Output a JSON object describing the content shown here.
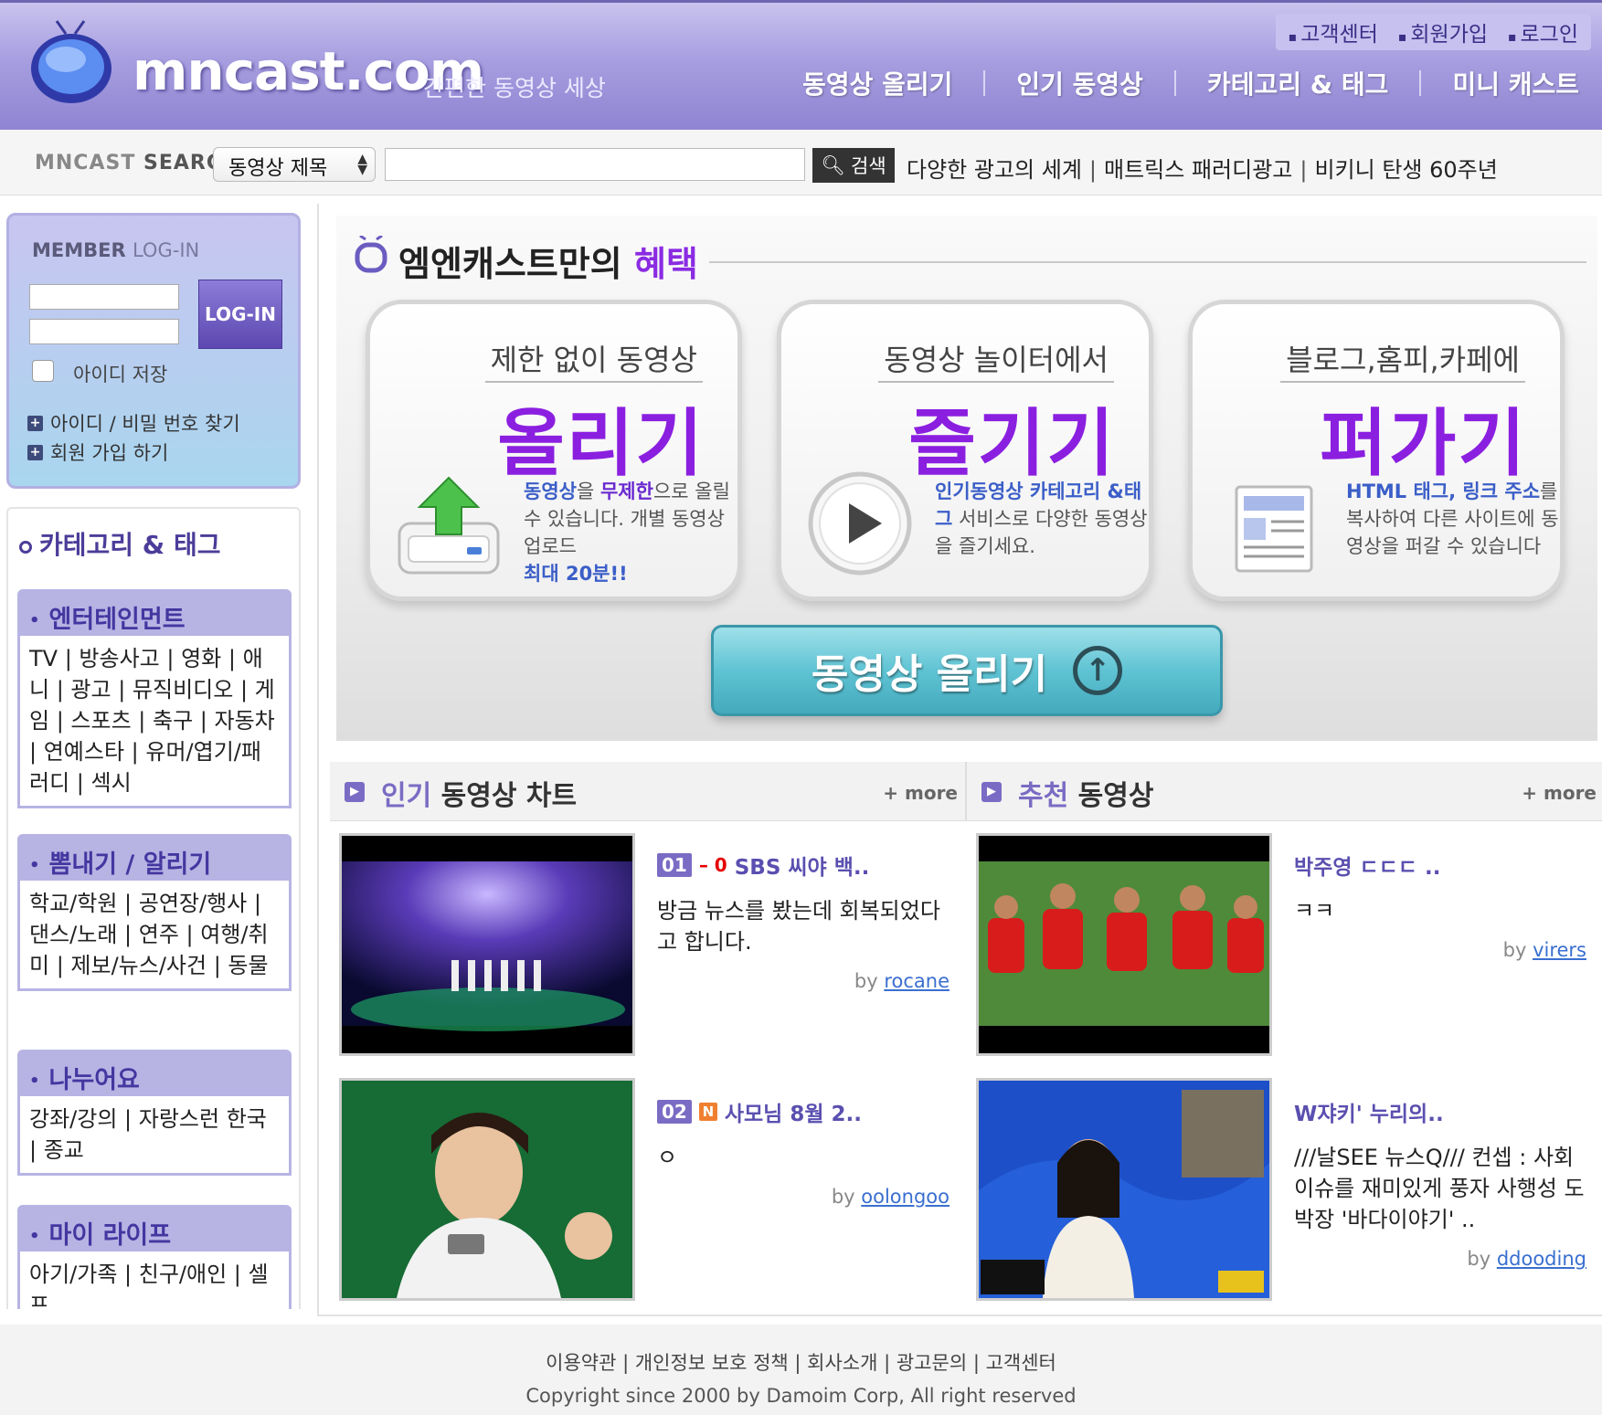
{
  "header": {
    "logo_text": "mncast.com",
    "slogan": "간편한 동영상 세상",
    "top_links": [
      "고객센터",
      "회원가입",
      "로그인"
    ],
    "nav": [
      "동영상 올리기",
      "인기 동영상",
      "카테고리 & 태그",
      "미니 캐스트"
    ]
  },
  "search": {
    "label_a": "MNCAST",
    "label_b": "SEARCH",
    "select_value": "동영상 제목",
    "input_value": "",
    "button_label": "검색",
    "keywords": [
      "다양한 광고의 세계",
      "매트릭스 패러디광고",
      "비키니 탄생 60주년"
    ]
  },
  "login": {
    "title_a": "MEMBER",
    "title_b": "LOG-IN",
    "button_label": "LOG-IN",
    "remember_label": "아이디 저장",
    "find_link": "아이디 / 비밀 번호 찾기",
    "join_link": "회원 가입 하기"
  },
  "categories": {
    "title": "카테고리 & 태그",
    "groups": [
      {
        "name": "엔터테인먼트",
        "items": "TV | 방송사고 | 영화 | 애니 | 광고 | 뮤직비디오 | 게임 | 스포츠 | 축구 | 자동차 | 연예스타 | 유머/엽기/패러디 | 섹시"
      },
      {
        "name": "뽐내기 / 알리기",
        "items": "학교/학원 | 공연장/행사 | 댄스/노래 | 연주 | 여행/취미 | 제보/뉴스/사건 | 동물"
      },
      {
        "name": "나누어요",
        "items": "강좌/강의 | 자랑스런 한국 | 종교"
      },
      {
        "name": "마이 라이프",
        "items": "아기/가족 | 친구/애인 | 셀프"
      }
    ]
  },
  "banner": {
    "title_a": "엠엔캐스트만의",
    "title_b": "혜택",
    "benefits": [
      {
        "sub": "제한 없이 동영상",
        "big": "올리기",
        "desc_a": "동영상",
        "desc_b": "을 ",
        "desc_c": "무제한",
        "desc_d": "으로 올릴 수 있습니다. 개별 동영상 업로드",
        "desc_e": "최대 20분!!"
      },
      {
        "sub": "동영상 놀이터에서",
        "big": "즐기기",
        "desc_a": "인기동영상 카테고리 &태그",
        "desc_b": " 서비스로 다양한 동영상을 즐기세요."
      },
      {
        "sub": "블로그,홈피,카페에",
        "big": "퍼가기",
        "desc_a": "HTML 태그, 링크 주소",
        "desc_b": "를 복사하여 다른 사이트에 동영상을 퍼갈 수 있습니다"
      }
    ],
    "upload_button": "동영상 올리기"
  },
  "popular": {
    "title_a": "인기",
    "title_b": "동영상 차트",
    "more": "+ more",
    "videos": [
      {
        "rank": "01",
        "change": "– 0",
        "title": "SBS 씨야 백..",
        "desc": "방금 뉴스를 봤는데 회복되었다고 합니다.",
        "by": "by",
        "user": "rocane"
      },
      {
        "rank": "02",
        "badge": "N",
        "title": "사모님 8월 2..",
        "desc": "ㅇ",
        "by": "by",
        "user": "oolongoo"
      }
    ]
  },
  "recommend": {
    "title_a": "추천",
    "title_b": "동영상",
    "more": "+ more",
    "videos": [
      {
        "title": "박주영 ㄷㄷㄷ ..",
        "desc": "ㅋㅋ",
        "by": "by",
        "user": "virers"
      },
      {
        "title": "W쟈키' 누리의..",
        "desc": "///날SEE 뉴스Q/// 컨셉 : 사회 이슈를 재미있게 풍자 사행성 도박장 '바다이야기' ..",
        "by": "by",
        "user": "ddooding"
      }
    ]
  },
  "footer": {
    "links": "이용약관 | 개인정보 보호 정책 | 회사소개 | 광고문의 | 고객센터",
    "copyright": "Copyright since 2000 by Damoim Corp, All right reserved"
  },
  "colors": {
    "header_purple": "#8f84d2",
    "accent_purple": "#7a6cc4",
    "highlight_violet": "#8b1fe0",
    "button_teal": "#5fc3d3"
  }
}
